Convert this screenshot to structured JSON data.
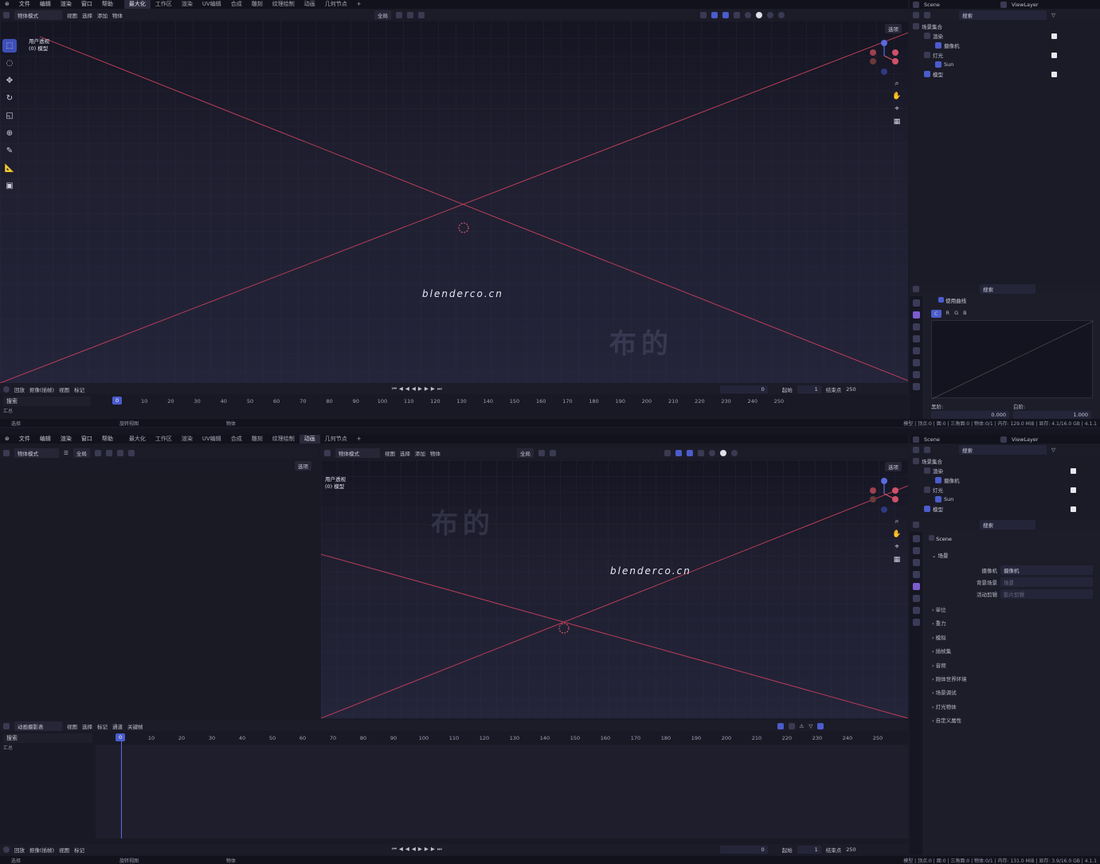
{
  "menu": [
    "文件",
    "编辑",
    "渲染",
    "窗口",
    "帮助"
  ],
  "workspaces_top": [
    "最大化",
    "工作区",
    "渲染",
    "UV编辑",
    "合成",
    "雕刻",
    "纹理绘制",
    "动画",
    "几何节点"
  ],
  "workspaces_bottom": [
    "最大化",
    "工作区",
    "渲染",
    "UV编辑",
    "合成",
    "雕刻",
    "纹理绘制",
    "动画",
    "几何节点"
  ],
  "add_tab": "+",
  "scene_name": "Scene",
  "view_layer": "ViewLayer",
  "search_placeholder": "搜索",
  "top": {
    "viewport_header": {
      "mode": "物体模式",
      "menus": [
        "视图",
        "选择",
        "添加",
        "物体"
      ],
      "transform": "全局",
      "options": "选项"
    },
    "overlay_line1": "用户透视",
    "overlay_line2": "(0) 模型",
    "watermark": "blenderco.cn",
    "watermark_cn": "布的",
    "outliner": {
      "collection": "场景集合",
      "rows": [
        {
          "label": "渲染",
          "indent": 1
        },
        {
          "label": "摄像机",
          "indent": 2
        },
        {
          "label": "灯光",
          "indent": 1
        },
        {
          "label": "Sun",
          "indent": 2
        },
        {
          "label": "模型",
          "indent": 1
        }
      ]
    },
    "props": {
      "use_curve": "使用曲线",
      "channels": [
        "C",
        "R",
        "G",
        "B"
      ],
      "black_label": "黑阶:",
      "white_label": "白阶:",
      "r_label": "R",
      "black_value": "0.000",
      "white_value": "1.000"
    },
    "timeline": {
      "header": [
        "回放",
        "抠像(插帧)",
        "视图",
        "标记"
      ],
      "current_frame": "0",
      "start_label": "起始",
      "start_value": "1",
      "end_label": "结束点",
      "end_value": "250",
      "search": "搜索",
      "summary": "汇总",
      "ticks": [
        "0",
        "10",
        "20",
        "30",
        "40",
        "50",
        "60",
        "70",
        "80",
        "90",
        "100",
        "110",
        "120",
        "130",
        "140",
        "150",
        "160",
        "170",
        "180",
        "190",
        "200",
        "210",
        "220",
        "230",
        "240",
        "250"
      ]
    },
    "status": {
      "left": "选择",
      "mid": "旋转视图",
      "right": "物体",
      "info": "模型 | 顶点:0 | 面:0 | 三角面:0 | 物体:0/1 | 内存: 129.0 MiB | 显存: 4.1/16.0 GB | 4.1.1"
    }
  },
  "bottom": {
    "left_header": {
      "mode": "物体模式",
      "transform": "全局",
      "options": "选项"
    },
    "viewport_header": {
      "mode": "物体模式",
      "menus": [
        "视图",
        "选择",
        "添加",
        "物体"
      ],
      "transform": "全局",
      "options": "选项"
    },
    "overlay_line1": "用户透视",
    "overlay_line2": "(0) 模型",
    "watermark": "blenderco.cn",
    "watermark_cn": "布的",
    "outliner": {
      "collection": "场景集合",
      "rows": [
        {
          "label": "渲染",
          "indent": 1
        },
        {
          "label": "摄像机",
          "indent": 2
        },
        {
          "label": "灯光",
          "indent": 1
        },
        {
          "label": "Sun",
          "indent": 2
        },
        {
          "label": "模型",
          "indent": 1
        }
      ]
    },
    "props": {
      "scene_title": "Scene",
      "section": "场景",
      "camera_label": "摄像机",
      "camera_value": "摄像机",
      "bg_scene_label": "背景场景",
      "bg_scene_value": "场景",
      "active_clip_label": "活动剪辑",
      "active_clip_value": "影片剪辑",
      "panels": [
        "单位",
        "重力",
        "模拟",
        "插帧集",
        "音频",
        "刚体世界环境",
        "场景调试",
        "灯光物体",
        "自定义属性"
      ]
    },
    "dopesheet": {
      "header": [
        "视图",
        "选择",
        "标记",
        "通道",
        "关键帧"
      ],
      "mode": "动画摄影表",
      "search": "搜索",
      "summary": "汇总",
      "ticks": [
        "0",
        "10",
        "20",
        "30",
        "40",
        "50",
        "60",
        "70",
        "80",
        "90",
        "100",
        "110",
        "120",
        "130",
        "140",
        "150",
        "160",
        "170",
        "180",
        "190",
        "200",
        "210",
        "220",
        "230",
        "240",
        "250"
      ]
    },
    "timeline": {
      "header": [
        "回放",
        "抠像(插帧)",
        "视图",
        "标记"
      ],
      "current_frame": "0",
      "start_label": "起始",
      "start_value": "1",
      "end_label": "结束点",
      "end_value": "250"
    },
    "status": {
      "left": "选择",
      "mid": "旋转视图",
      "right": "物体",
      "info": "模型 | 顶点:0 | 面:0 | 三角面:0 | 物体:0/1 | 内存: 131.0 MiB | 显存: 3.9/16.0 GB | 4.1.1"
    }
  },
  "colors": {
    "accent": "#4b5ccc",
    "axis_x": "#c8405a",
    "bg": "#1a1a26"
  }
}
